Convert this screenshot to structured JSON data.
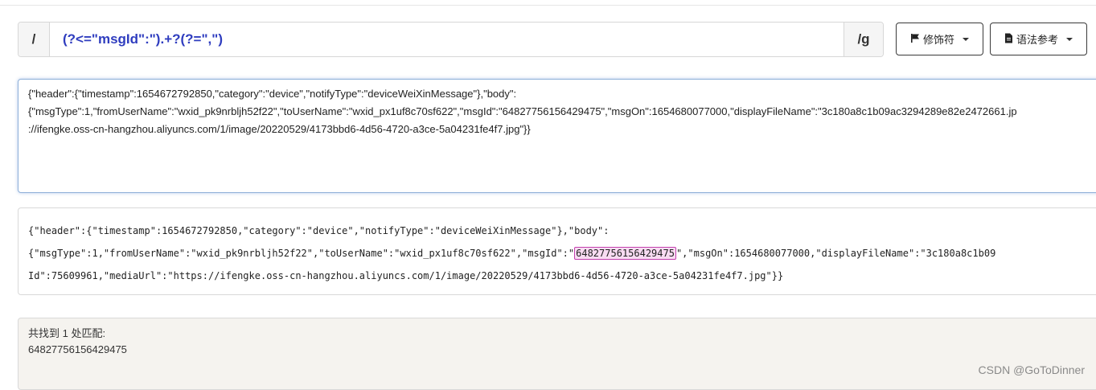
{
  "regex": {
    "delimiter_open": "/",
    "pattern": "(?<=\"msgId\":\").+?(?=\",\")",
    "flags": "/g"
  },
  "buttons": {
    "modifiers_label": "修饰符",
    "modifiers_icon": "flag-icon",
    "syntax_label": "语法参考",
    "syntax_icon": "document-icon"
  },
  "source_text": {
    "line1": "{\"header\":{\"timestamp\":1654672792850,\"category\":\"device\",\"notifyType\":\"deviceWeiXinMessage\"},\"body\":",
    "line2": "{\"msgType\":1,\"fromUserName\":\"wxid_pk9nrbljh52f22\",\"toUserName\":\"wxid_px1uf8c70sf622\",\"msgId\":\"64827756156429475\",\"msgOn\":1654680077000,\"displayFileName\":\"3c180a8c1b09ac3294289e82e2472661.jp",
    "line3": "://ifengke.oss-cn-hangzhou.aliyuncs.com/1/image/20220529/4173bbd6-4d56-4720-a3ce-5a04231fe4f7.jpg\"}}"
  },
  "result_text": {
    "line1": "{\"header\":{\"timestamp\":1654672792850,\"category\":\"device\",\"notifyType\":\"deviceWeiXinMessage\"},\"body\":",
    "line2_before": "{\"msgType\":1,\"fromUserName\":\"wxid_pk9nrbljh52f22\",\"toUserName\":\"wxid_px1uf8c70sf622\",\"msgId\":\"",
    "line2_match": "64827756156429475",
    "line2_after": "\",\"msgOn\":1654680077000,\"displayFileName\":\"3c180a8c1b09",
    "line3": "Id\":75609961,\"mediaUrl\":\"https://ifengke.oss-cn-hangzhou.aliyuncs.com/1/image/20220529/4173bbd6-4d56-4720-a3ce-5a04231fe4f7.jpg\"}}"
  },
  "matches": {
    "summary": "共找到 1 处匹配:",
    "items": [
      "64827756156429475"
    ]
  },
  "watermark": "CSDN @GoToDinner",
  "colors": {
    "pattern_text": "#2f3dbf",
    "highlight_bg": "#f8dcf2",
    "highlight_border": "#c23fae",
    "match_panel_bg": "#f5f3ef"
  }
}
